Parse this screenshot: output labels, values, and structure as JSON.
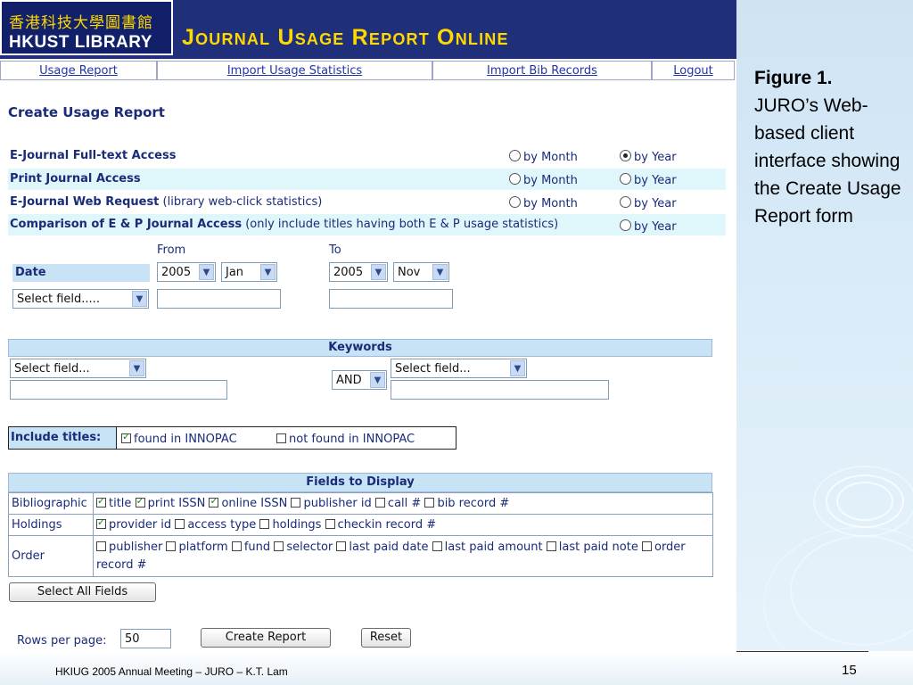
{
  "header": {
    "logo_cn": "香港科技大學圖書館",
    "logo_en": "HKUST LIBRARY",
    "title": "Journal Usage Report Online"
  },
  "nav": [
    "Usage Report",
    "Import Usage Statistics",
    "Import Bib Records",
    "Logout"
  ],
  "form": {
    "title": "Create Usage Report",
    "report_types": [
      {
        "label": "E-Journal Full-text Access",
        "note": "",
        "options": [
          "by Month",
          "by Year"
        ],
        "selected": "by Year"
      },
      {
        "label": "Print Journal Access",
        "note": "",
        "options": [
          "by Month",
          "by Year"
        ],
        "selected": ""
      },
      {
        "label": "E-Journal Web Request",
        "note": "(library web-click statistics)",
        "options": [
          "by Month",
          "by Year"
        ],
        "selected": ""
      },
      {
        "label": "Comparison of E & P Journal Access",
        "note": "(only include titles having both E & P usage statistics)",
        "options": [
          "by Year"
        ],
        "selected": ""
      }
    ],
    "date": {
      "from_label": "From",
      "to_label": "To",
      "date_label": "Date",
      "from_year": "2005",
      "from_month": "Jan",
      "to_year": "2005",
      "to_month": "Nov",
      "field_select": "Select field.....",
      "from_value": "",
      "to_value": ""
    },
    "keywords": {
      "title": "Keywords",
      "field1": "Select field...",
      "operator": "AND",
      "field2": "Select field...",
      "value1": "",
      "value2": ""
    },
    "include": {
      "label": "Include titles:",
      "options": [
        {
          "label": "found in INNOPAC",
          "checked": true
        },
        {
          "label": "not found in INNOPAC",
          "checked": false
        }
      ]
    },
    "fields_display": {
      "title": "Fields to Display",
      "groups": [
        {
          "name": "Bibliographic",
          "fields": [
            {
              "label": "title",
              "checked": true
            },
            {
              "label": "print ISSN",
              "checked": true
            },
            {
              "label": "online ISSN",
              "checked": true
            },
            {
              "label": "publisher id",
              "checked": false
            },
            {
              "label": "call #",
              "checked": false
            },
            {
              "label": "bib record #",
              "checked": false
            }
          ]
        },
        {
          "name": "Holdings",
          "fields": [
            {
              "label": "provider id",
              "checked": true
            },
            {
              "label": "access type",
              "checked": false
            },
            {
              "label": "holdings",
              "checked": false
            },
            {
              "label": "checkin record #",
              "checked": false
            }
          ]
        },
        {
          "name": "Order",
          "fields": [
            {
              "label": "publisher",
              "checked": false
            },
            {
              "label": "platform",
              "checked": false
            },
            {
              "label": "fund",
              "checked": false
            },
            {
              "label": "selector",
              "checked": false
            },
            {
              "label": "last paid date",
              "checked": false
            },
            {
              "label": "last paid amount",
              "checked": false
            },
            {
              "label": "last paid note",
              "checked": false
            },
            {
              "label": "order record #",
              "checked": false
            }
          ]
        }
      ]
    },
    "select_all": "Select All Fields",
    "rows_label": "Rows per page:",
    "rows_value": "50",
    "create_btn": "Create Report",
    "reset_btn": "Reset"
  },
  "caption": {
    "bold": "Figure 1.",
    "text": "JURO’s Web-based client interface showing the Create Usage Report form"
  },
  "footer": {
    "text": "HKIUG 2005 Annual Meeting – JURO – K.T. Lam",
    "page": "15"
  }
}
